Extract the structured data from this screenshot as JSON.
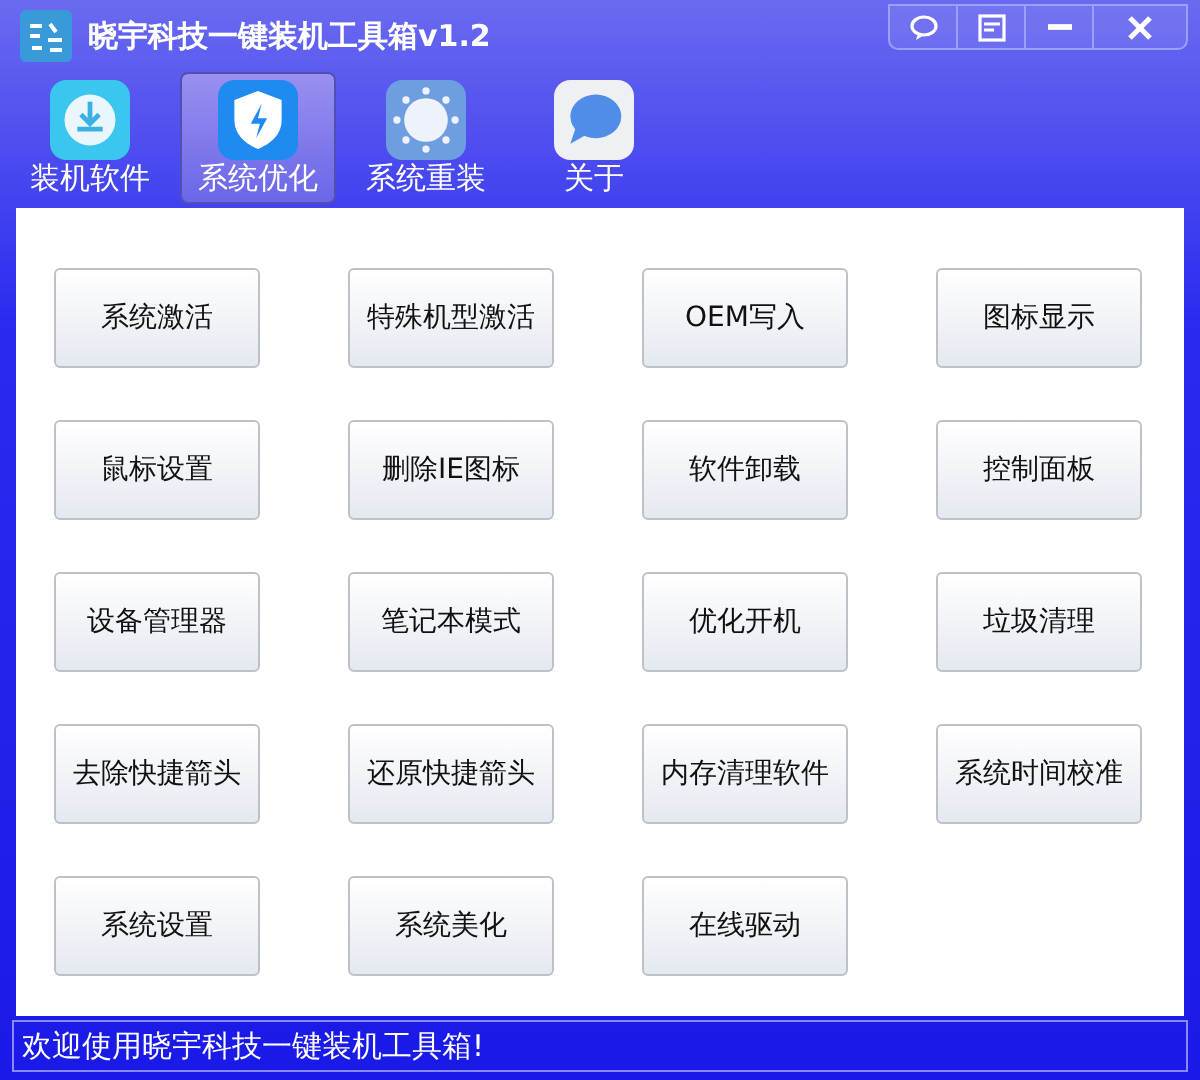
{
  "window": {
    "title": "晓宇科技一键装机工具箱v1.2"
  },
  "tabs": [
    {
      "label": "装机软件",
      "selected": false
    },
    {
      "label": "系统优化",
      "selected": true
    },
    {
      "label": "系统重装",
      "selected": false
    },
    {
      "label": "关于",
      "selected": false
    }
  ],
  "buttons": [
    "系统激活",
    "特殊机型激活",
    "OEM写入",
    "图标显示",
    "鼠标设置",
    "删除IE图标",
    "软件卸载",
    "控制面板",
    "设备管理器",
    "笔记本模式",
    "优化开机",
    "垃圾清理",
    "去除快捷箭头",
    "还原快捷箭头",
    "内存清理软件",
    "系统时间校准",
    "系统设置",
    "系统美化",
    "在线驱动"
  ],
  "status_bar": "欢迎使用晓宇科技一键装机工具箱!"
}
